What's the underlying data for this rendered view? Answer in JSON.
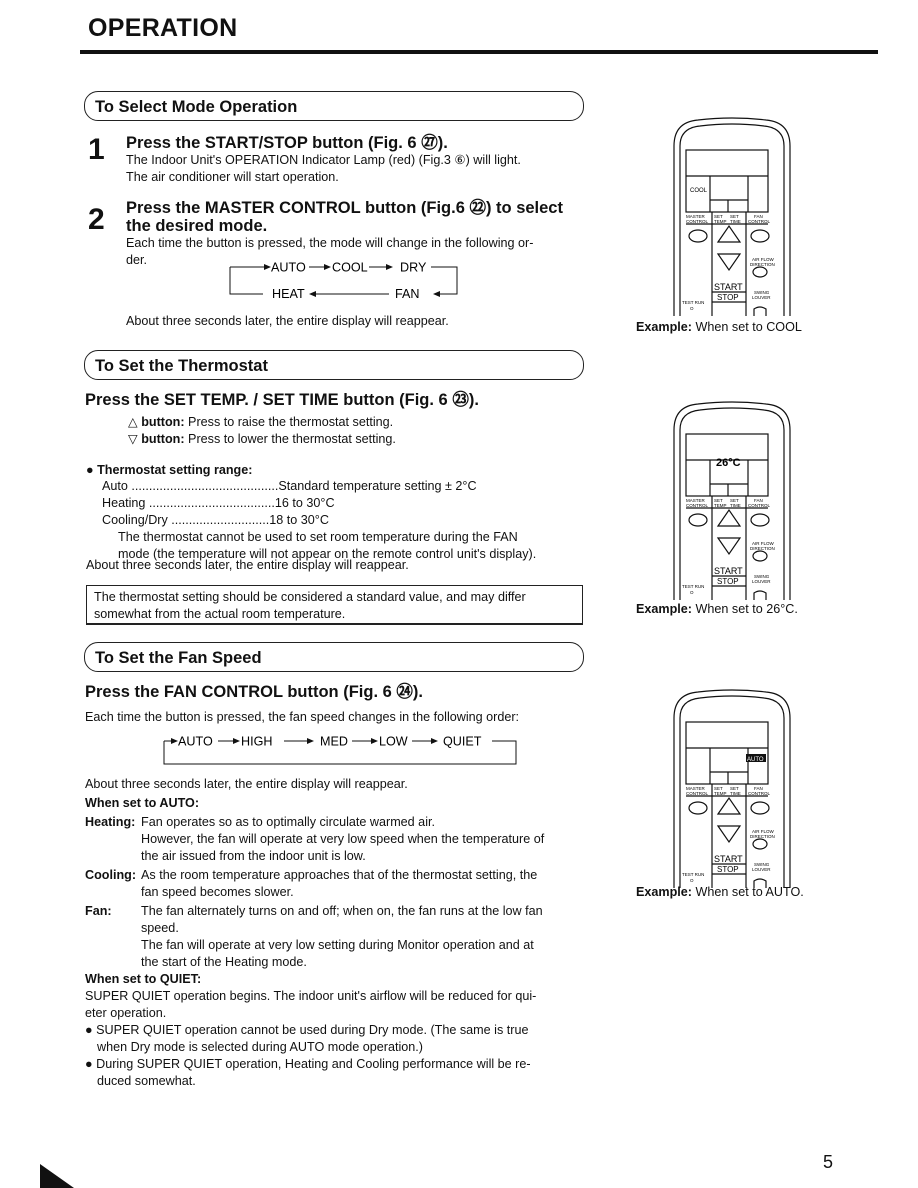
{
  "page": {
    "title": "OPERATION",
    "page_number": "5"
  },
  "mode": {
    "header": "To Select Mode Operation",
    "step1": {
      "number": "1",
      "heading": "Press the START/STOP button (Fig. 6 ㉗).",
      "lines": [
        "The Indoor Unit's OPERATION Indicator Lamp (red) (Fig.3 ⑥) will light.",
        "The air conditioner will start operation."
      ]
    },
    "step2": {
      "number": "2",
      "heading1": "Press the MASTER CONTROL button (Fig.6 ㉒)  to select",
      "heading2": "the desired mode.",
      "lines": [
        "Each time the button is pressed, the mode will change in the following or-",
        "der."
      ]
    },
    "cycle": [
      "AUTO",
      "COOL",
      "DRY",
      "FAN",
      "HEAT"
    ],
    "after": "About three seconds later, the entire display will reappear."
  },
  "thermostat": {
    "header": "To Set the Thermostat",
    "heading": "Press the SET TEMP. / SET TIME button (Fig. 6 ㉓).",
    "up": {
      "label": "button:",
      "text": " Press to raise the thermostat setting."
    },
    "down": {
      "label": "button:",
      "text": " Press to lower the thermostat setting."
    },
    "range_title": "Thermostat setting range:",
    "ranges": [
      {
        "mode": "Auto",
        "dots": " ..........................................",
        "value": "Standard temperature setting ± 2°C"
      },
      {
        "mode": "Heating",
        "dots": " ....................................",
        "value": "16 to 30°C"
      },
      {
        "mode": "Cooling/Dry",
        "dots": " ............................",
        "value": "18 to 30°C"
      }
    ],
    "fan_note": [
      "The thermostat cannot be used to set room temperature during the FAN",
      "mode (the temperature will not appear on the remote control unit's display)."
    ],
    "after": "About three seconds later, the entire display will reappear.",
    "box": [
      "The thermostat setting should be considered a standard value, and may differ",
      "somewhat from the actual room temperature."
    ]
  },
  "fan": {
    "header": "To Set the Fan Speed",
    "heading": "Press the FAN CONTROL button (Fig. 6 ㉔).",
    "intro": "Each time the button is pressed, the fan speed changes in the following order:",
    "cycle": [
      "AUTO",
      "HIGH",
      "MED",
      "LOW",
      "QUIET"
    ],
    "after": "About three seconds later, the entire display will reappear.",
    "auto_title": "When set to AUTO:",
    "heating": {
      "label": "Heating:",
      "lines": [
        "Fan operates so as to optimally circulate warmed air.",
        "However, the fan will operate at very low speed when the temperature of",
        "the air issued from the indoor unit is low."
      ]
    },
    "cooling": {
      "label": "Cooling:",
      "lines": [
        "As the room temperature approaches that of the thermostat setting, the",
        "fan speed becomes slower."
      ]
    },
    "fanmode": {
      "label": "Fan:",
      "lines": [
        "The fan alternately turns on and off; when on, the fan runs at the low fan",
        "speed.",
        "The fan will operate at very low setting during Monitor operation and at",
        "the start of the Heating mode."
      ]
    },
    "quiet_title": "When set to QUIET:",
    "quiet_lines": [
      "SUPER QUIET operation begins. The indoor unit's airflow will be reduced for qui-",
      "eter operation."
    ],
    "bullets": [
      [
        "SUPER QUIET operation cannot be used during Dry mode. (The same is true",
        "when Dry mode is selected during AUTO mode operation.)"
      ],
      [
        "During SUPER QUIET operation, Heating and Cooling performance will be re-",
        "duced somewhat."
      ]
    ]
  },
  "remote_labels": {
    "master1": "MASTER",
    "master2": "CONTROL",
    "set": "SET",
    "temp": "TEMP",
    "time": "TIME",
    "fan1": "FAN",
    "fan2": "CONTROL",
    "air1": "AIR FLOW",
    "air2": "DIRECTION",
    "start": "START",
    "stop": "STOP",
    "swing1": "SWING",
    "swing2": "LOUVER",
    "test1": "TEST RUN",
    "test2": "O"
  },
  "examples": [
    {
      "display": "COOL",
      "label": "Example:",
      "text": " When set to COOL"
    },
    {
      "display": "26°C",
      "label": "Example:",
      "text": " When set to 26°C."
    },
    {
      "display": "AUTO",
      "label": "Example:",
      "text": " When set to AUTO."
    }
  ]
}
